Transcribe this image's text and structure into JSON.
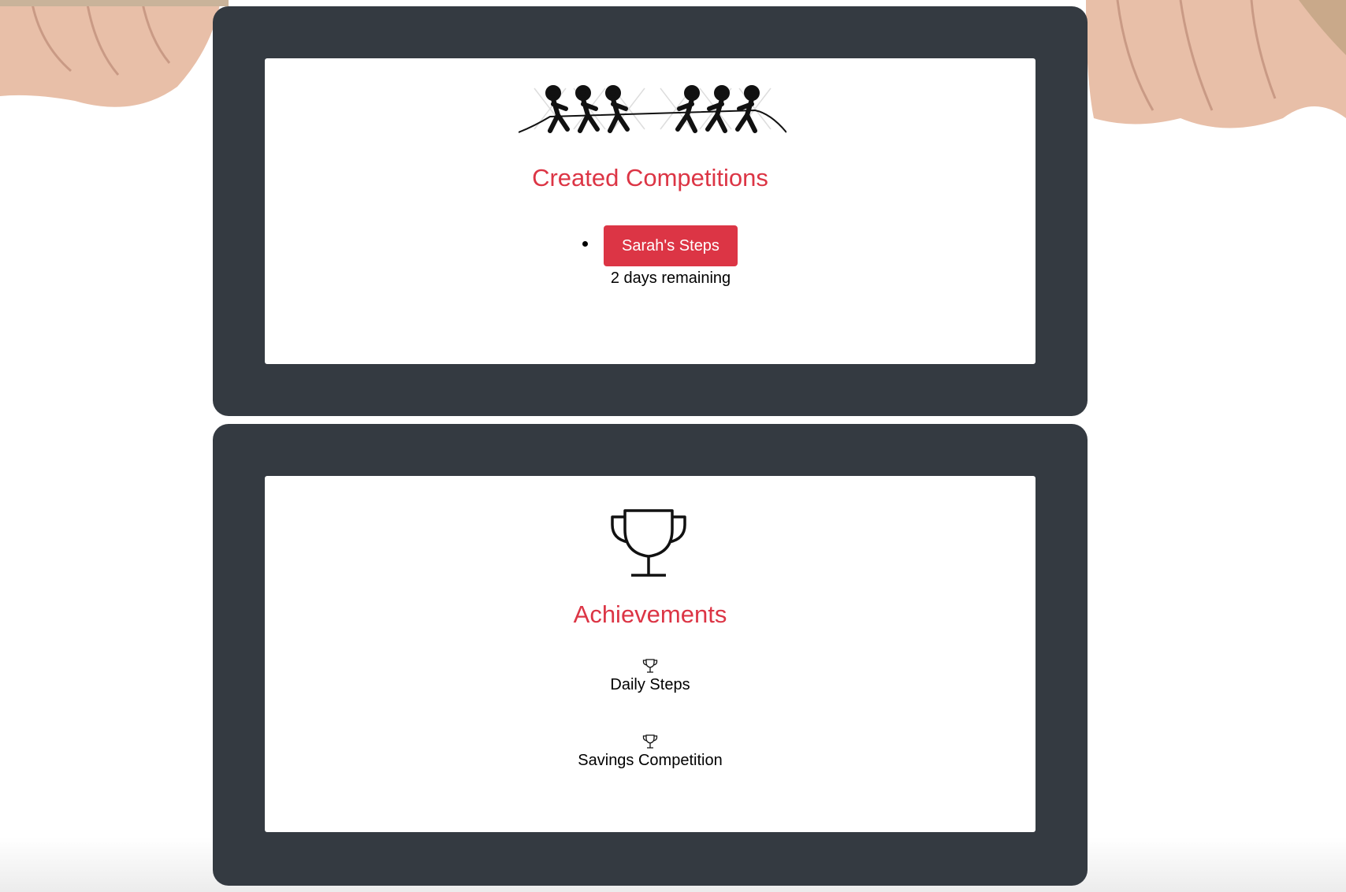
{
  "competitions": {
    "title": "Created Competitions",
    "items": [
      {
        "name": "Sarah's Steps",
        "remaining": "2 days remaining"
      }
    ]
  },
  "achievements": {
    "title": "Achievements",
    "items": [
      {
        "label": "Daily Steps"
      },
      {
        "label": "Savings Competition"
      }
    ]
  },
  "colors": {
    "accent": "#dc3545",
    "panel": "#343a41",
    "card": "#ffffff"
  },
  "icons": {
    "competitions": "tug-of-war-icon",
    "achievements": "trophy-icon"
  }
}
